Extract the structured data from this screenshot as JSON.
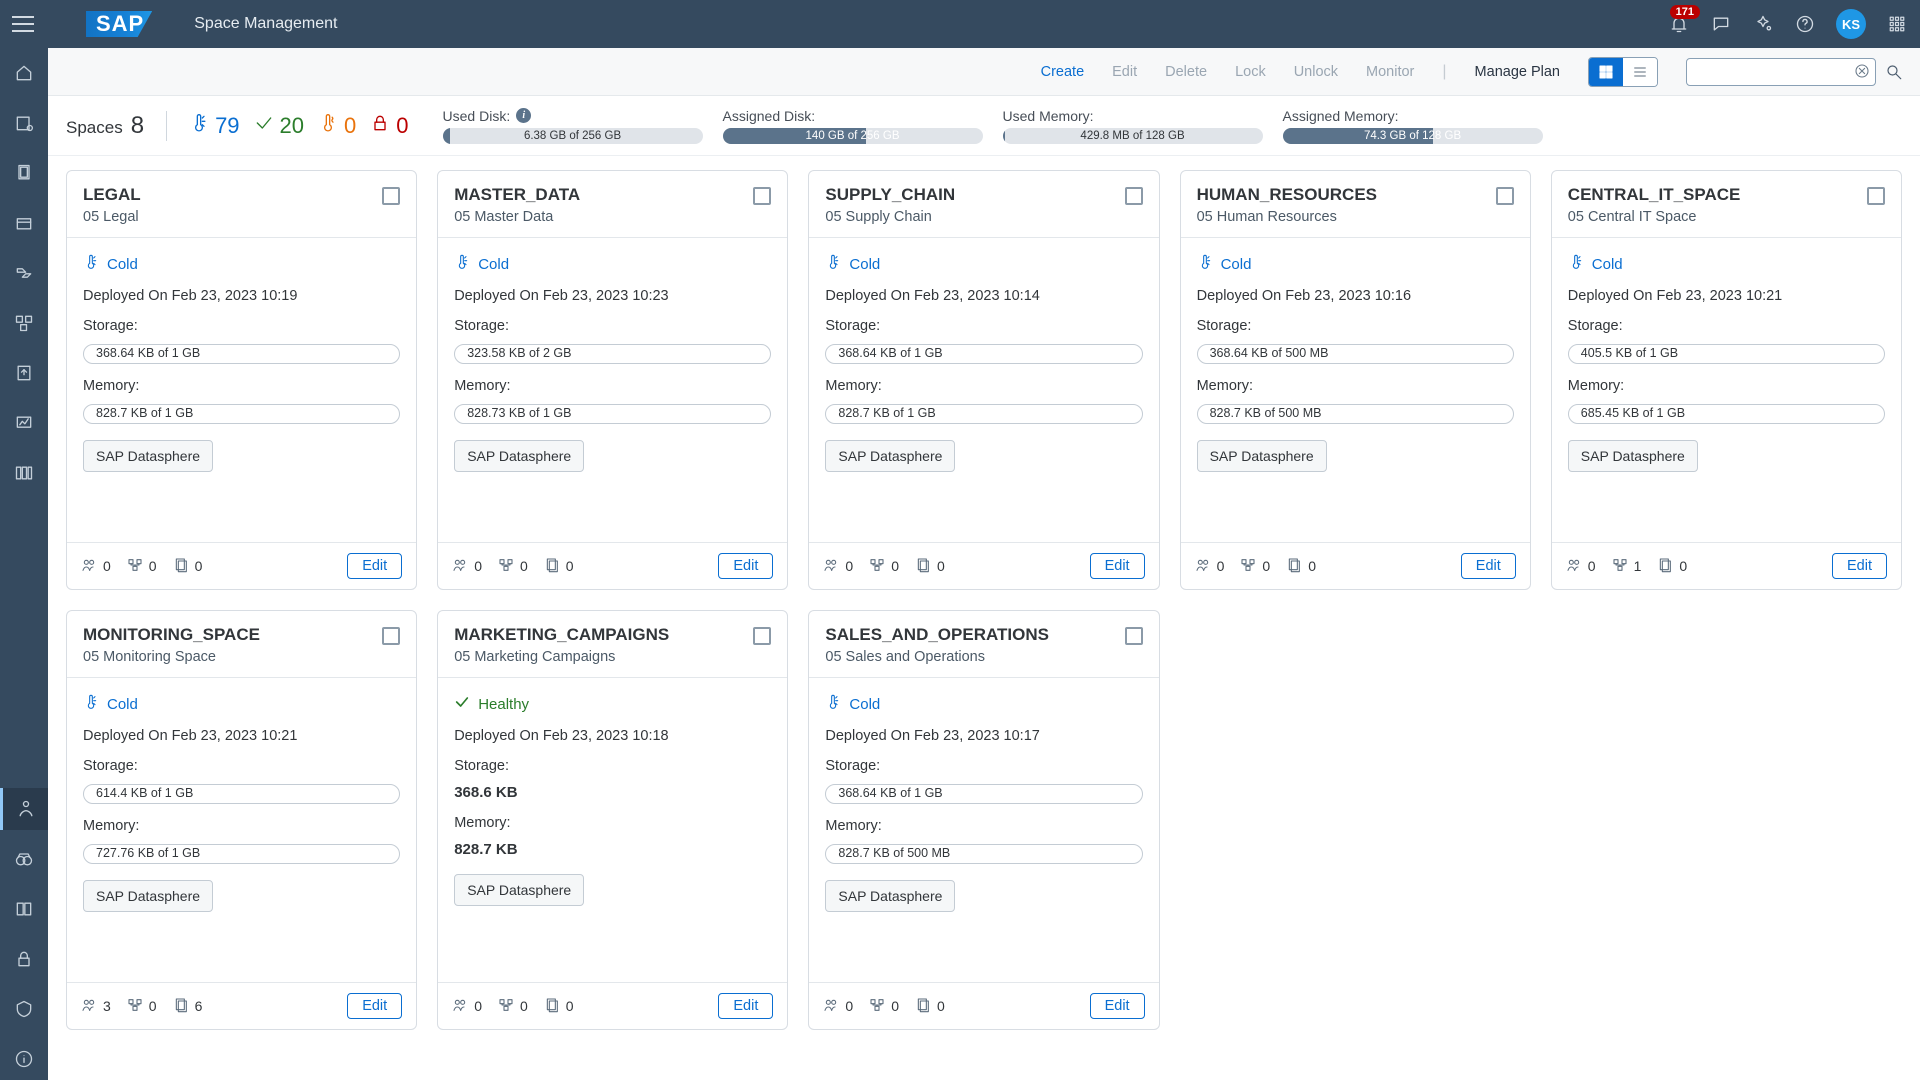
{
  "shell": {
    "app_title": "Space Management",
    "user_initials": "KS",
    "notification_count": "171"
  },
  "toolbar": {
    "actions": {
      "create": "Create",
      "edit": "Edit",
      "delete": "Delete",
      "lock": "Lock",
      "unlock": "Unlock",
      "monitor": "Monitor",
      "manage_plan": "Manage Plan"
    },
    "search_placeholder": ""
  },
  "summary": {
    "spaces_label": "Spaces",
    "spaces_count": "8",
    "cold_count": "79",
    "healthy_count": "20",
    "warn_count": "0",
    "lock_count": "0",
    "metrics": [
      {
        "label": "Used Disk:",
        "text": "6.38 GB of 256 GB",
        "fill_pct": 3,
        "info": true
      },
      {
        "label": "Assigned Disk:",
        "text": "140 GB of 256 GB",
        "fill_pct": 55,
        "info": false
      },
      {
        "label": "Used Memory:",
        "text": "429.8 MB of 128 GB",
        "fill_pct": 1,
        "info": false
      },
      {
        "label": "Assigned Memory:",
        "text": "74.3 GB of 128 GB",
        "fill_pct": 58,
        "info": false
      }
    ]
  },
  "common": {
    "status_cold": "Cold",
    "status_healthy": "Healthy",
    "storage_label": "Storage:",
    "memory_label": "Memory:",
    "tag_label": "SAP Datasphere",
    "edit_label": "Edit"
  },
  "cards": [
    {
      "title": "LEGAL",
      "subtitle": "05 Legal",
      "status": "cold",
      "deployed": "Deployed On Feb 23, 2023 10:19",
      "storage": "368.64 KB of 1 GB",
      "memory": "828.7 KB of 1 GB",
      "storage_mode": "bar",
      "memory_mode": "bar",
      "users": "0",
      "deploys": "0",
      "copies": "0"
    },
    {
      "title": "MASTER_DATA",
      "subtitle": "05 Master Data",
      "status": "cold",
      "deployed": "Deployed On Feb 23, 2023 10:23",
      "storage": "323.58 KB of 2 GB",
      "memory": "828.73 KB of 1 GB",
      "storage_mode": "bar",
      "memory_mode": "bar",
      "users": "0",
      "deploys": "0",
      "copies": "0"
    },
    {
      "title": "SUPPLY_CHAIN",
      "subtitle": "05 Supply Chain",
      "status": "cold",
      "deployed": "Deployed On Feb 23, 2023 10:14",
      "storage": "368.64 KB of 1 GB",
      "memory": "828.7 KB of 1 GB",
      "storage_mode": "bar",
      "memory_mode": "bar",
      "users": "0",
      "deploys": "0",
      "copies": "0"
    },
    {
      "title": "HUMAN_RESOURCES",
      "subtitle": "05 Human Resources",
      "status": "cold",
      "deployed": "Deployed On Feb 23, 2023 10:16",
      "storage": "368.64 KB of 500 MB",
      "memory": "828.7 KB of 500 MB",
      "storage_mode": "bar",
      "memory_mode": "bar",
      "users": "0",
      "deploys": "0",
      "copies": "0"
    },
    {
      "title": "CENTRAL_IT_SPACE",
      "subtitle": "05 Central IT Space",
      "status": "cold",
      "deployed": "Deployed On Feb 23, 2023 10:21",
      "storage": "405.5 KB of 1 GB",
      "memory": "685.45 KB of 1 GB",
      "storage_mode": "bar",
      "memory_mode": "bar",
      "users": "0",
      "deploys": "1",
      "copies": "0"
    },
    {
      "title": "MONITORING_SPACE",
      "subtitle": "05 Monitoring Space",
      "status": "cold",
      "deployed": "Deployed On Feb 23, 2023 10:21",
      "storage": "614.4 KB of 1 GB",
      "memory": "727.76 KB of 1 GB",
      "storage_mode": "bar",
      "memory_mode": "bar",
      "users": "3",
      "deploys": "0",
      "copies": "6"
    },
    {
      "title": "MARKETING_CAMPAIGNS",
      "subtitle": "05 Marketing Campaigns",
      "status": "healthy",
      "deployed": "Deployed On Feb 23, 2023 10:18",
      "storage": "368.6 KB",
      "memory": "828.7 KB",
      "storage_mode": "plain",
      "memory_mode": "plain",
      "users": "0",
      "deploys": "0",
      "copies": "0"
    },
    {
      "title": "SALES_AND_OPERATIONS",
      "subtitle": "05 Sales and Operations",
      "status": "cold",
      "deployed": "Deployed On Feb 23, 2023 10:17",
      "storage": "368.64 KB of 1 GB",
      "memory": "828.7 KB of 500 MB",
      "storage_mode": "bar",
      "memory_mode": "bar",
      "users": "0",
      "deploys": "0",
      "copies": "0"
    }
  ]
}
